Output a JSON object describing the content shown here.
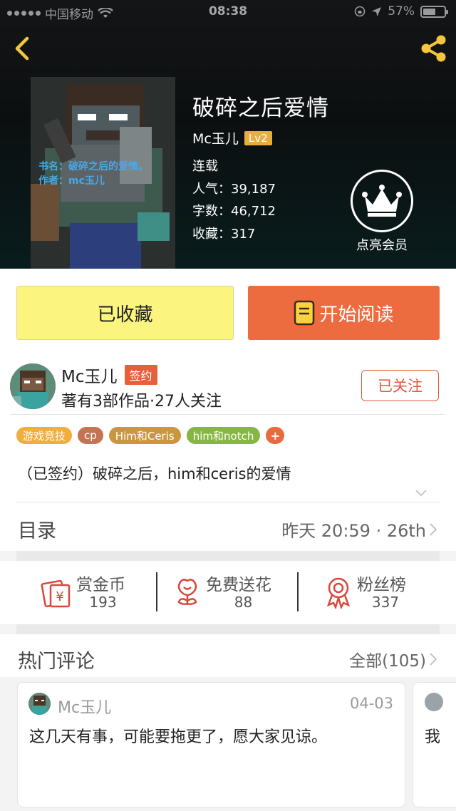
{
  "status_bar": {
    "carrier": "中国移动",
    "time": "08:38",
    "battery": "57%"
  },
  "book": {
    "title": "破碎之后爱情",
    "author": "Mc玉儿",
    "level": "Lv2",
    "status": "连载",
    "popularity_label": "人气：",
    "popularity": "39,187",
    "words_label": "字数：",
    "words": "46,712",
    "favorites_label": "收藏：",
    "favorites": "317",
    "cover_title": "书名：破碎之后的爱情。",
    "cover_author": "作者：mc玉儿"
  },
  "vip": {
    "label": "点亮会员"
  },
  "actions": {
    "favorite_label": "已收藏",
    "read_label": "开始阅读"
  },
  "author_card": {
    "name": "Mc玉儿",
    "badge": "签约",
    "info": "著有3部作品·27人关注",
    "follow_label": "已关注"
  },
  "tags": [
    {
      "label": "游戏竞技",
      "color": "#f2ad3c"
    },
    {
      "label": "cp",
      "color": "#c47453"
    },
    {
      "label": "Him和Ceris",
      "color": "#c9983c"
    },
    {
      "label": "him和notch",
      "color": "#86b743"
    },
    {
      "label": "+",
      "color": "#e96a3f"
    }
  ],
  "description": "（已签约）破碎之后，him和ceris的爱情",
  "catalog": {
    "title": "目录",
    "update": "昨天 20:59 · 26th"
  },
  "stats": {
    "coins_label": "赏金币",
    "coins": "193",
    "flowers_label": "免费送花",
    "flowers": "88",
    "fans_label": "粉丝榜",
    "fans": "337"
  },
  "comments": {
    "title": "热门评论",
    "all_label": "全部(105)",
    "items": [
      {
        "user": "Mc玉儿",
        "date": "04-03",
        "text": "这几天有事，可能要拖更了，愿大家见谅。"
      },
      {
        "text": "我"
      }
    ]
  },
  "colors": {
    "accent_orange": "#ec6b3f",
    "favorite_yellow": "#fbf47e",
    "level_badge": "#e9ad3a"
  }
}
